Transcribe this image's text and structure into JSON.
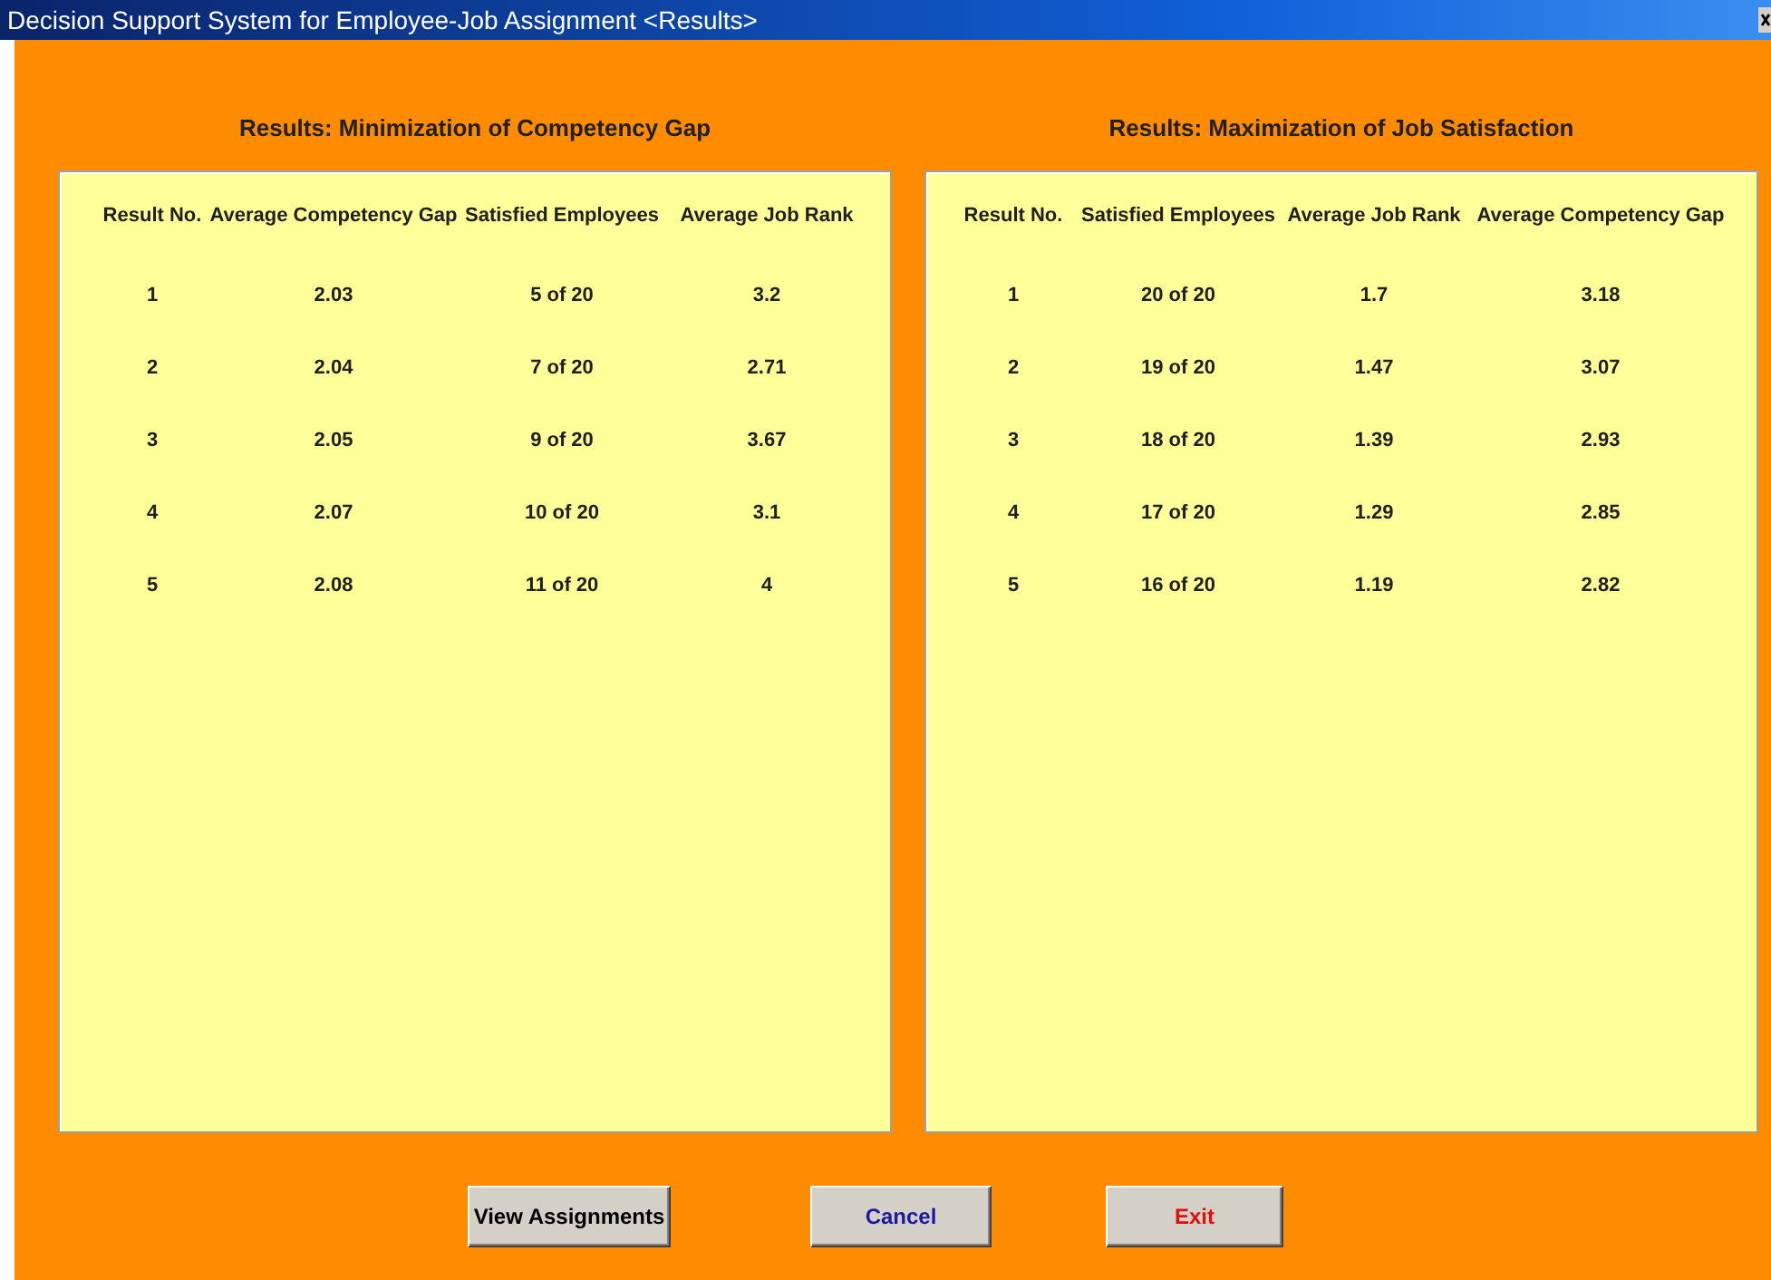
{
  "window": {
    "title": "Decision Support System for Employee-Job Assignment <Results>"
  },
  "panels": [
    {
      "heading": "Results:  Minimization of Competency Gap",
      "columns": [
        "Result No.",
        "Average Competency Gap",
        "Satisfied Employees",
        "Average Job Rank"
      ],
      "rows": [
        [
          "1",
          "2.03",
          "5 of  20",
          "3.2"
        ],
        [
          "2",
          "2.04",
          "7 of  20",
          "2.71"
        ],
        [
          "3",
          "2.05",
          "9 of  20",
          "3.67"
        ],
        [
          "4",
          "2.07",
          "10 of  20",
          "3.1"
        ],
        [
          "5",
          "2.08",
          "11 of  20",
          "4"
        ]
      ]
    },
    {
      "heading": "Results:  Maximization of Job Satisfaction",
      "columns": [
        "Result No.",
        "Satisfied Employees",
        "Average Job Rank",
        "Average Competency Gap"
      ],
      "rows": [
        [
          "1",
          "20 of 20",
          "1.7",
          "3.18"
        ],
        [
          "2",
          "19 of 20",
          "1.47",
          "3.07"
        ],
        [
          "3",
          "18 of 20",
          "1.39",
          "2.93"
        ],
        [
          "4",
          "17 of 20",
          "1.29",
          "2.85"
        ],
        [
          "5",
          "16 of 20",
          "1.19",
          "2.82"
        ]
      ]
    }
  ],
  "buttons": [
    {
      "label": "View Assignments",
      "color": "#000000"
    },
    {
      "label": "Cancel",
      "color": "#1a1aa0"
    },
    {
      "label": "Exit",
      "color": "#e01010"
    }
  ]
}
